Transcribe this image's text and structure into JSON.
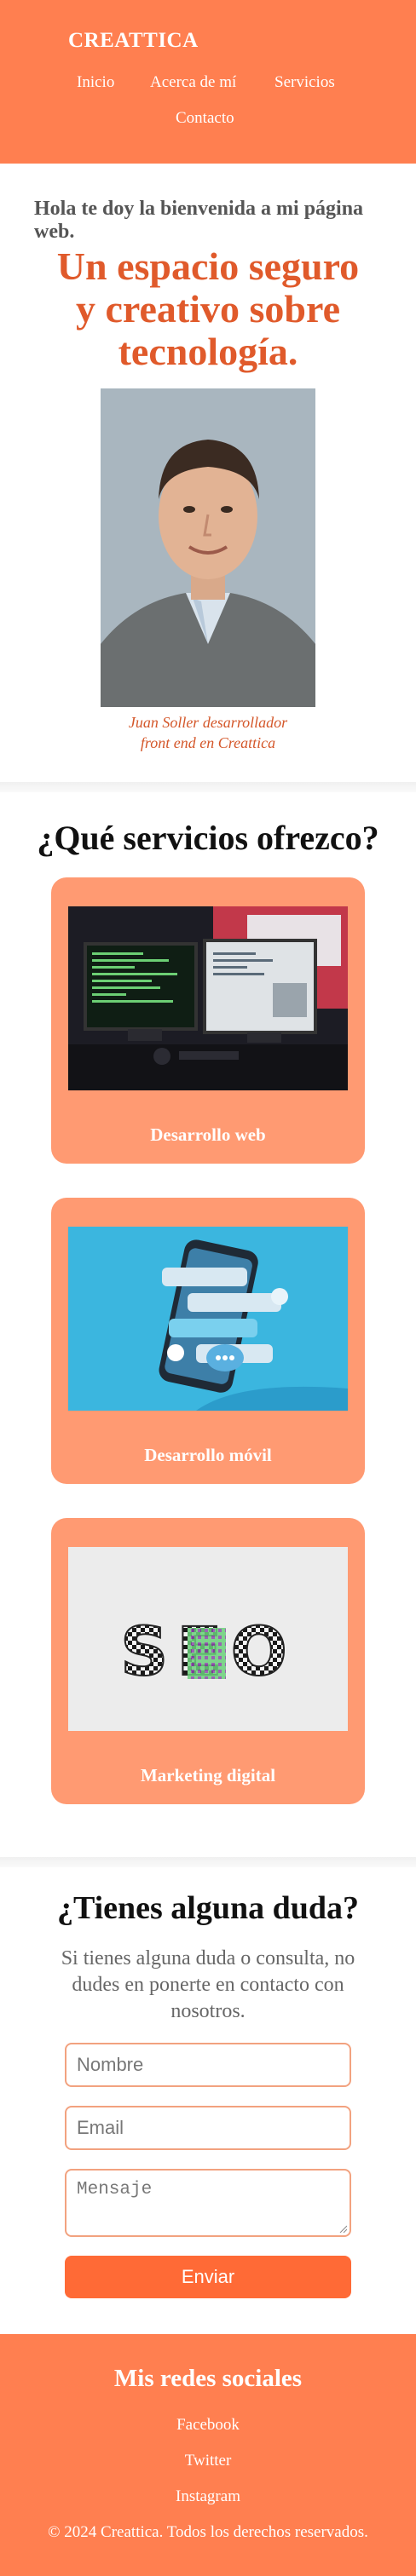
{
  "header": {
    "brand": "CREATTICA",
    "nav": [
      "Inicio",
      "Acerca de mí",
      "Servicios",
      "Contacto"
    ]
  },
  "hero": {
    "welcome": "Hola te doy la bienvenida a mi página web.",
    "headline_line1": "Un espacio seguro",
    "headline_line2": "y creativo sobre",
    "headline_line3": "tecnología.",
    "caption_line1": "Juan Soller desarrollador",
    "caption_line2": "front end en Creattica"
  },
  "services": {
    "title": "¿Qué servicios ofrezco?",
    "cards": [
      "Desarrollo web",
      "Desarrollo móvil",
      "Marketing digital"
    ],
    "seo_text": "SEO"
  },
  "contact": {
    "title": "¿Tienes alguna duda?",
    "text": "Si tienes alguna duda o consulta, no dudes en ponerte en contacto con nosotros.",
    "name_placeholder": "Nombre",
    "email_placeholder": "Email",
    "message_placeholder": "Mensaje",
    "send_label": "Enviar"
  },
  "footer": {
    "title": "Mis redes sociales",
    "links": [
      "Facebook",
      "Twitter",
      "Instagram"
    ],
    "copyright": "© 2024 Creattica. Todos los derechos reservados."
  },
  "colors": {
    "accent": "#ff7f50",
    "headline": "#e05a2b",
    "card": "#ff9a72",
    "button": "#ff6a36"
  }
}
